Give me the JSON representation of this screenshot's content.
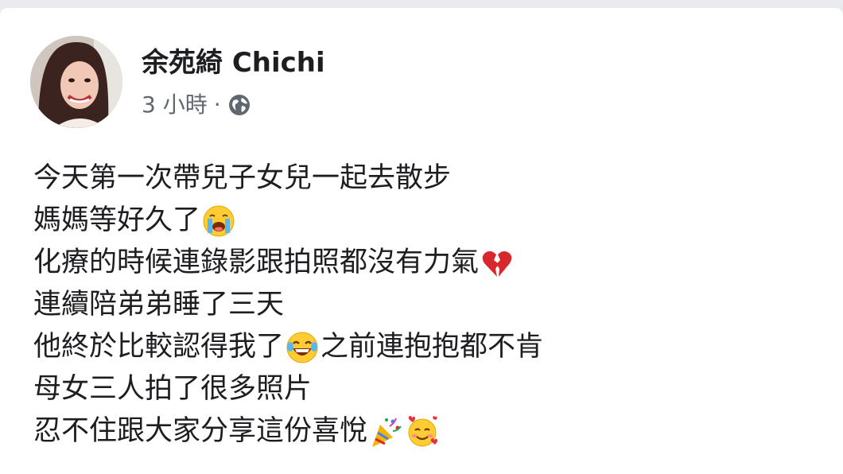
{
  "post": {
    "author": "余苑綺 Chichi",
    "timestamp": "3 小時",
    "separator": "·",
    "privacy_icon": "globe-icon",
    "lines": [
      {
        "text": "今天第一次帶兒子女兒一起去散步",
        "emoji_after": null
      },
      {
        "text": "媽媽等好久了",
        "emoji_after": "crying-face"
      },
      {
        "text": "化療的時候連錄影跟拍照都沒有力氣",
        "emoji_after": "broken-heart"
      },
      {
        "text": "連續陪弟弟睡了三天",
        "emoji_after": null
      },
      {
        "text": "他終於比較認得我了",
        "emoji_after": "tears-of-joy",
        "text_after": "之前連抱抱都不肯"
      },
      {
        "text": "母女三人拍了很多照片",
        "emoji_after": null
      },
      {
        "text": "忍不住跟大家分享這份喜悅",
        "emoji_after": "party-popper",
        "emoji_after_2": "smiling-face-with-hearts"
      }
    ]
  },
  "colors": {
    "text": "#1c1e21",
    "secondary_text": "#606770",
    "background": "#e9ebee",
    "card": "#ffffff"
  }
}
